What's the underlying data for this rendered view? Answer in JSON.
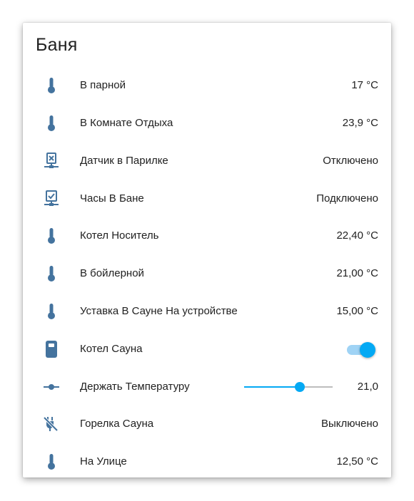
{
  "card": {
    "title": "Баня"
  },
  "colors": {
    "icon": "#44739e",
    "accent": "#03a9f4",
    "track": "#9fd3f5",
    "rail": "#bdbdbd"
  },
  "rows": [
    {
      "icon": "thermometer-icon",
      "label": "В парной",
      "value": "17 °C"
    },
    {
      "icon": "thermometer-icon",
      "label": "В Комнате Отдыха",
      "value": "23,9 °C"
    },
    {
      "icon": "network-off-icon",
      "label": "Датчик в Парилке",
      "value": "Отключено"
    },
    {
      "icon": "network-ok-icon",
      "label": "Часы В Бане",
      "value": "Подключено"
    },
    {
      "icon": "thermometer-icon",
      "label": "Котел Носитель",
      "value": "22,40 °C"
    },
    {
      "icon": "thermometer-icon",
      "label": "В бойлерной",
      "value": "21,00 °C"
    },
    {
      "icon": "thermometer-icon",
      "label": "Уставка В Сауне На устройстве",
      "value": "15,00 °C"
    },
    {
      "icon": "boiler-icon",
      "label": "Котел Сауна",
      "toggle": true
    },
    {
      "icon": "slider-icon",
      "label": "Держать Температуру",
      "value": "21,0",
      "slider": {
        "fraction": 0.63
      }
    },
    {
      "icon": "power-plug-off-icon",
      "label": "Горелка Сауна",
      "value": "Выключено"
    },
    {
      "icon": "thermometer-icon",
      "label": "На Улице",
      "value": "12,50 °C"
    }
  ]
}
